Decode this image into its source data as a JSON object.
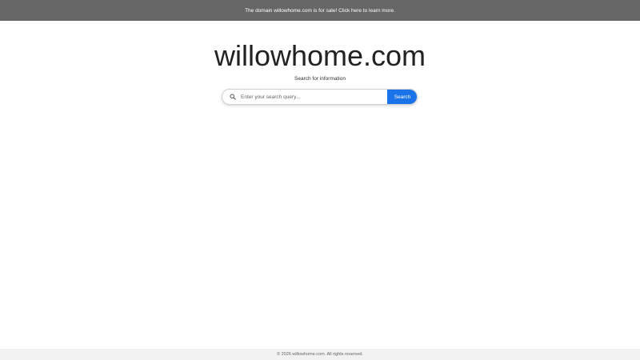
{
  "banner": {
    "text": "The domain willowhome.com is for sale! Click here to learn more."
  },
  "main": {
    "title": "willowhome.com",
    "subtitle": "Search for information"
  },
  "search": {
    "placeholder": "Enter your search query...",
    "value": "",
    "button_label": "Search",
    "icon": "search-icon"
  },
  "footer": {
    "text": "© 2026 willowhome.com. All rights reserved."
  },
  "colors": {
    "banner_bg": "#666666",
    "button_bg": "#1a73e8",
    "footer_bg": "#f2f2f2"
  }
}
